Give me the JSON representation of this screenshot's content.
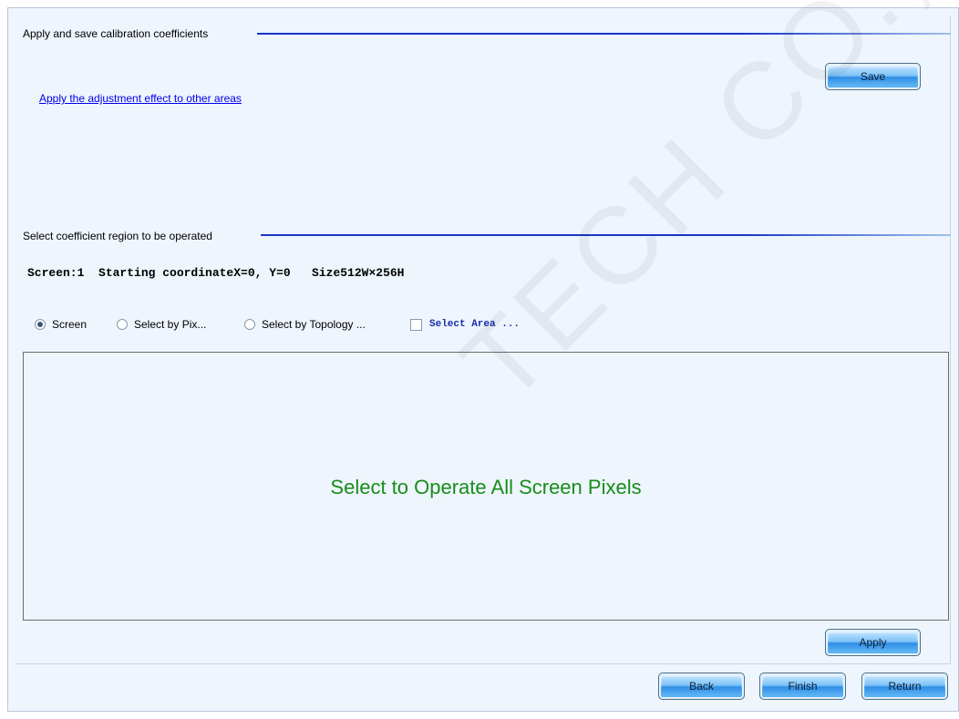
{
  "section_apply": {
    "title": "Apply and save calibration coefficients",
    "link_text": "Apply the adjustment effect to other areas",
    "save_button": "Save"
  },
  "section_region": {
    "title": "Select coefficient region to be operated",
    "info": "Screen:1  Starting coordinateX=0, Y=0   Size512W×256H",
    "options": {
      "screen": "Screen",
      "pixel": "Select by Pix...",
      "topology": "Select by Topology ...",
      "area": "Select Area ..."
    },
    "selected_option": "Screen",
    "canvas_message": "Select to Operate All Screen Pixels",
    "apply_button": "Apply"
  },
  "footer": {
    "back_button": "Back",
    "finish_button": "Finish",
    "return_button": "Return"
  },
  "watermark": "TECH CO., LTD",
  "colors": {
    "panel_bg": "#eef5fc",
    "group_line": "#1a35c8",
    "link": "#0000ee",
    "canvas_message": "#178d1a",
    "area_label": "#1a2db0"
  }
}
